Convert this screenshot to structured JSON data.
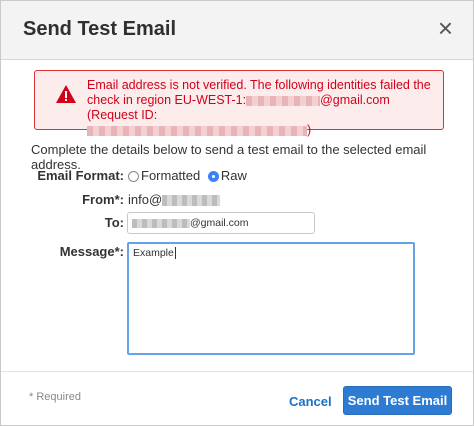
{
  "dialog": {
    "title": "Send Test Email",
    "close_glyph": "×"
  },
  "error": {
    "line1": "Email address is not verified. The following identities failed the",
    "line2_prefix": "check in region EU-WEST-1:",
    "line2_suffix": "@gmail.com (Request ID:",
    "line3_suffix": ")"
  },
  "intro": "Complete the details below to send a test email to the selected email address.",
  "form": {
    "format_label": "Email Format:",
    "format_option_formatted": "Formatted",
    "format_option_raw": "Raw",
    "format_selected": "Raw",
    "from_label": "From*:",
    "from_prefix": "info@",
    "to_label": "To:",
    "to_suffix": "@gmail.com",
    "message_label": "Message*:",
    "message_value": "Example"
  },
  "footer": {
    "required_note": "* Required",
    "cancel_label": "Cancel",
    "send_label": "Send Test Email"
  },
  "colors": {
    "error": "#d0021b",
    "primary": "#2e7bd3",
    "link": "#1d6fc4"
  },
  "icons": {
    "error": "warning-triangle-icon",
    "close": "close-icon"
  }
}
